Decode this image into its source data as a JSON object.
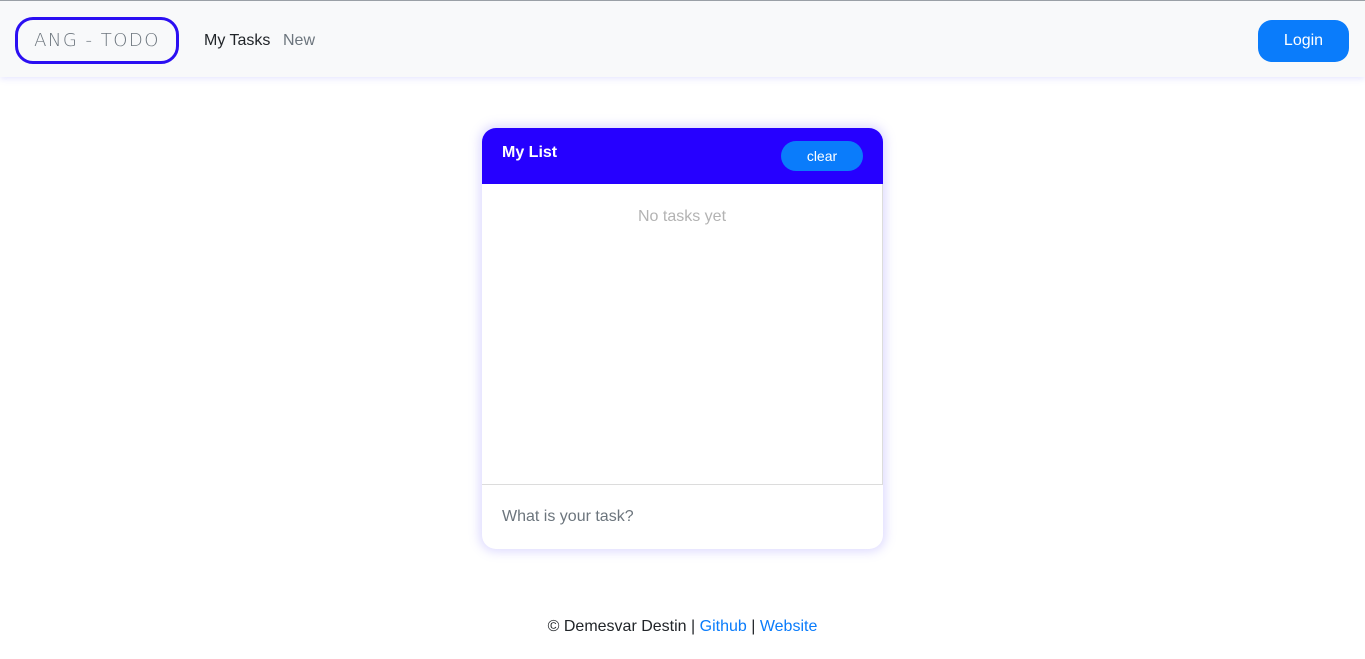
{
  "navbar": {
    "brand": "ANG - TODO",
    "links": [
      {
        "label": "My Tasks",
        "active": true
      },
      {
        "label": "New",
        "active": false
      }
    ],
    "login_label": "Login"
  },
  "list_card": {
    "title": "My List",
    "clear_label": "clear",
    "empty_message": "No tasks yet",
    "input_placeholder": "What is your task?",
    "input_value": ""
  },
  "footer": {
    "credit": "© Demesvar Destin",
    "separator": "|",
    "github_label": "Github",
    "website_label": "Website"
  },
  "colors": {
    "primary": "#0a7cfb",
    "header_accent": "#2600ff",
    "brand_border": "#2b0ff2"
  }
}
